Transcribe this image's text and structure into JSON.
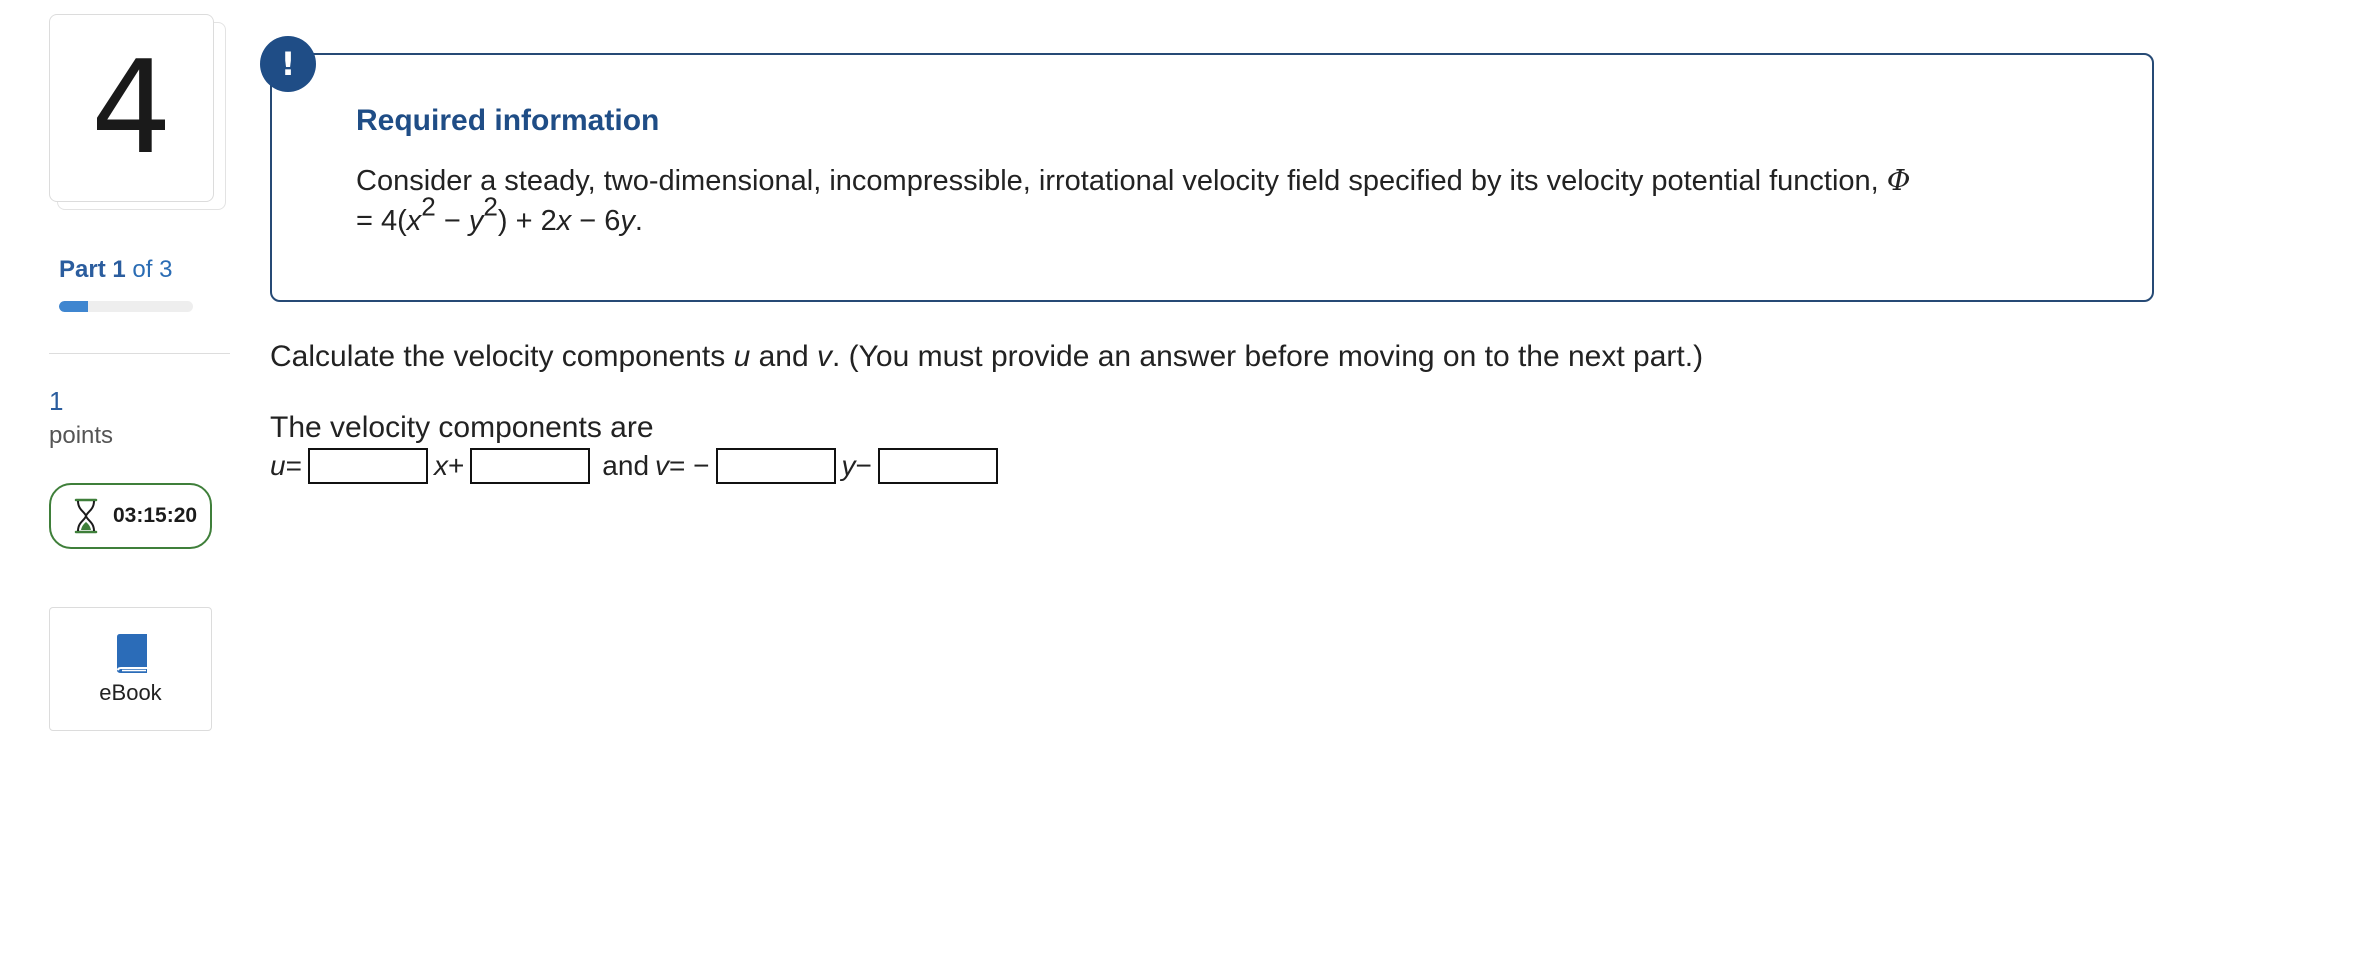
{
  "question": {
    "number": "4",
    "part": {
      "prefix": "Part",
      "current": "1",
      "suffix": "of 3",
      "progress_fraction": 0.22
    },
    "points": {
      "value": "1",
      "label": "points"
    },
    "timer": "03:15:20",
    "ebook_label": "eBook"
  },
  "info": {
    "badge": "!",
    "title": "Required information",
    "line1_text": "Consider a steady, two-dimensional, incompressible, irrotational velocity field specified by its velocity potential function, ",
    "phi": "Φ",
    "line2": {
      "eq": "= 4(",
      "x": "x",
      "exp1": "2",
      "minus": " − ",
      "y": "y",
      "exp2": "2",
      "rest": ") + 2",
      "x2": "x",
      "minus6": " − 6",
      "y2": "y",
      "period": "."
    }
  },
  "prompt": {
    "before_u": "Calculate the velocity components ",
    "u": "u",
    "and": " and ",
    "v": "v",
    "after": ". (You must provide an answer before moving on to the next part.)"
  },
  "answer": {
    "heading": "The velocity components are",
    "u_label": "u",
    "equals": " = ",
    "x_plus": "x",
    "plus": " + ",
    "and_word": "and",
    "v_label": "v",
    "v_equals": " = −",
    "y_minus": "y",
    "minus": " −"
  },
  "colors": {
    "accent": "#1f4d86",
    "timer_border": "#3f7f3a",
    "progress": "#3f86d0"
  },
  "icons": [
    "alert-icon",
    "hourglass-icon",
    "book-icon"
  ]
}
